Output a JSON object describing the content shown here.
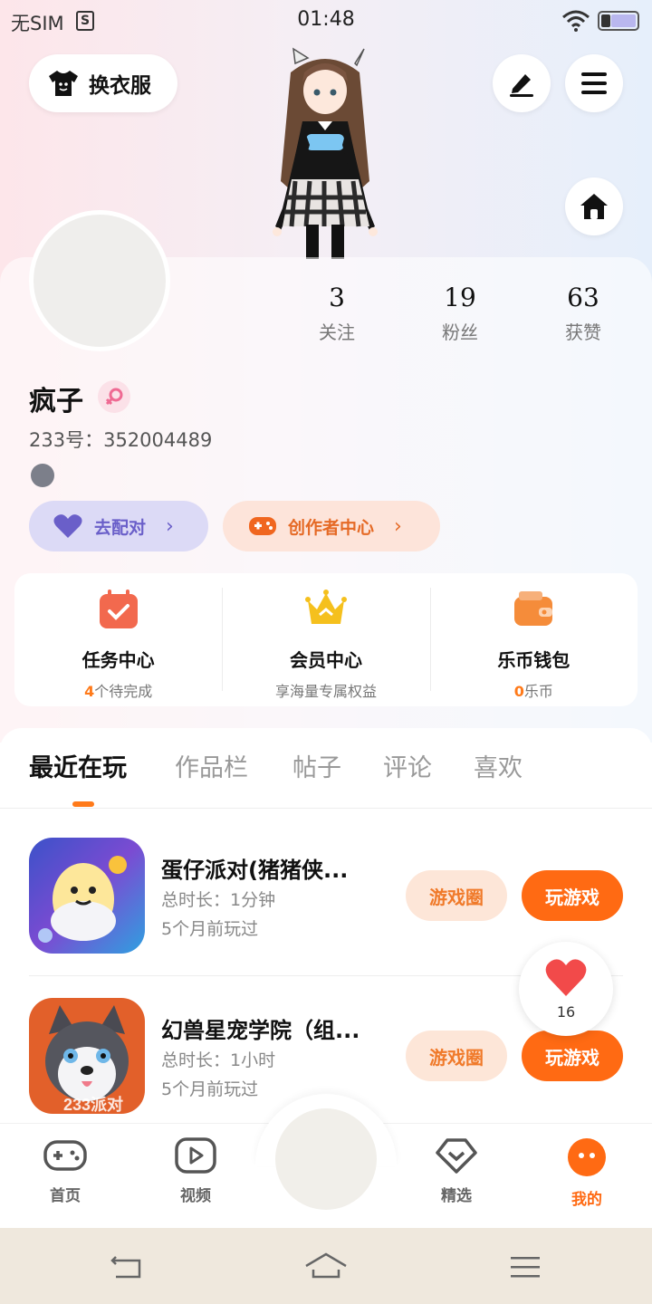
{
  "status_bar": {
    "sim": "无SIM",
    "time": "01:48"
  },
  "top": {
    "outfit_label": "换衣服",
    "icons": [
      "tshirt-icon",
      "pen-icon",
      "menu-icon",
      "home-icon"
    ]
  },
  "profile": {
    "stats": [
      {
        "num": "3",
        "label": "关注"
      },
      {
        "num": "19",
        "label": "粉丝"
      },
      {
        "num": "63",
        "label": "获赞"
      }
    ],
    "username": "疯子",
    "uid": "233号：352004489",
    "match_label": "去配对",
    "creator_label": "创作者中心"
  },
  "services": [
    {
      "title": "任务中心",
      "highlight": "4",
      "sub": "个待完成"
    },
    {
      "title": "会员中心",
      "highlight": "",
      "sub": "享海量专属权益"
    },
    {
      "title": "乐币钱包",
      "highlight": "0",
      "sub": "乐币"
    }
  ],
  "tabs": [
    "最近在玩",
    "作品栏",
    "帖子",
    "评论",
    "喜欢"
  ],
  "games": [
    {
      "name": "蛋仔派对(猪猪侠...",
      "duration": "总时长：1分钟",
      "last_played": "5个月前玩过",
      "circle_label": "游戏圈",
      "play_label": "玩游戏"
    },
    {
      "name": "幻兽星宠学院（组...",
      "duration": "总时长：1小时",
      "last_played": "5个月前玩过",
      "circle_label": "游戏圈",
      "play_label": "玩游戏",
      "thumb_text": "233派对"
    }
  ],
  "like_float": {
    "count": "16"
  },
  "bottom_nav": [
    {
      "label": "首页"
    },
    {
      "label": "视频"
    },
    {
      "label": "精选"
    },
    {
      "label": "我的"
    }
  ],
  "colors": {
    "accent": "#ff6a13",
    "match_bg": "#dcdaf6",
    "creator_bg": "#fde4da"
  }
}
